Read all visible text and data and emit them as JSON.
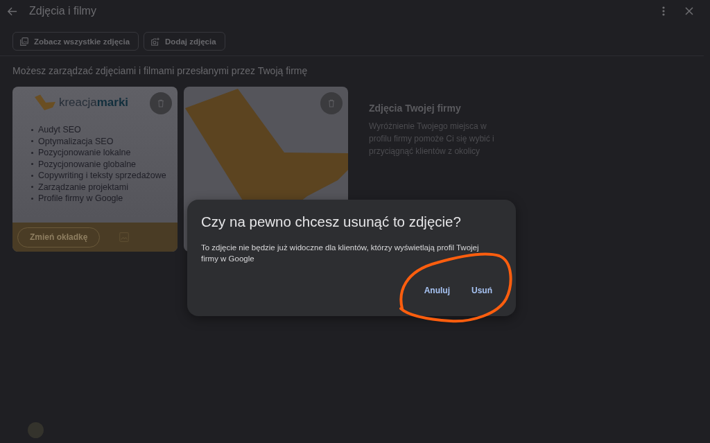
{
  "header": {
    "title": "Zdjęcia i filmy"
  },
  "actions": [
    {
      "label": "Zobacz wszystkie zdjęcia",
      "kind": "gallery"
    },
    {
      "label": "Dodaj zdjęcia",
      "kind": "add-photo"
    }
  ],
  "description": "Możesz zarządzać zdjęciami i filmami przesłanymi przez Twoją firmę",
  "photos": [
    {
      "kind": "cover",
      "logo": "kreacja**marki**",
      "services": [
        "Audyt SEO",
        "Optymalizacja SEO",
        "Pozycjonowanie lokalne",
        "Pozycjonowanie globalne",
        "Copywriting i teksty sprzedażowe",
        "Zarządzanie projektami",
        "Profile firmy w Google"
      ],
      "cover_button": "Zmień okładkę"
    },
    {
      "kind": "image"
    }
  ],
  "info": {
    "title": "Zdjęcia Twojej firmy",
    "text": "Wyróżnienie Twojego miejsca w profilu firmy pomoże Ci się wybić i przyciągnąć klientów z okolicy"
  },
  "dialog": {
    "title": "Czy na pewno chcesz usunąć to zdjęcie?",
    "message": "To zdjęcie nie będzie już widoczne dla klientów, którzy wyświetlają profil Twojej firmy w Google",
    "buttons": [
      "Anuluj",
      "Usuń"
    ]
  }
}
